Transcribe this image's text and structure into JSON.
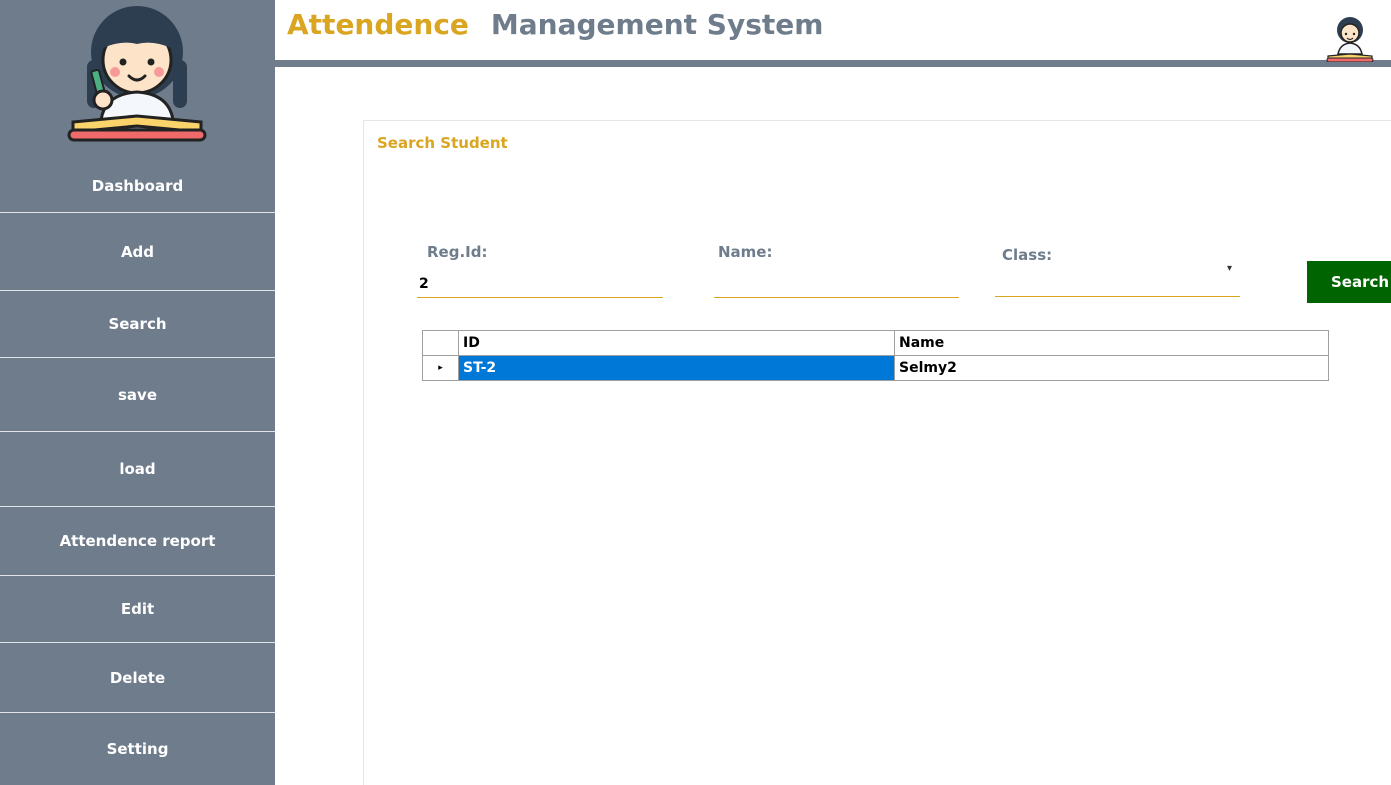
{
  "header": {
    "title_word1": "Attendence",
    "title_word2": "Management System"
  },
  "sidebar": {
    "items": [
      {
        "label": "Dashboard"
      },
      {
        "label": "Add"
      },
      {
        "label": "Search"
      },
      {
        "label": "save"
      },
      {
        "label": "load"
      },
      {
        "label": "Attendence report"
      },
      {
        "label": "Edit"
      },
      {
        "label": "Delete"
      },
      {
        "label": "Setting"
      }
    ]
  },
  "panel": {
    "title": "Search Student",
    "fields": {
      "regid_label": "Reg.Id:",
      "regid_value": "2",
      "name_label": "Name:",
      "name_value": "",
      "class_label": "Class:",
      "class_value": ""
    },
    "search_button": "Search"
  },
  "grid": {
    "headers": [
      "ID",
      "Name"
    ],
    "rows": [
      {
        "id": "ST-2",
        "name": "Selmy2"
      }
    ],
    "row_indicator": "▸"
  },
  "colors": {
    "sidebar": "#6e7c8c",
    "accent": "#daa520",
    "button": "#006400",
    "selection": "#0078d7"
  },
  "icons": {
    "logo": "student-reading-icon",
    "avatar": "student-avatar-icon",
    "dropdown": "chevron-down-icon"
  }
}
